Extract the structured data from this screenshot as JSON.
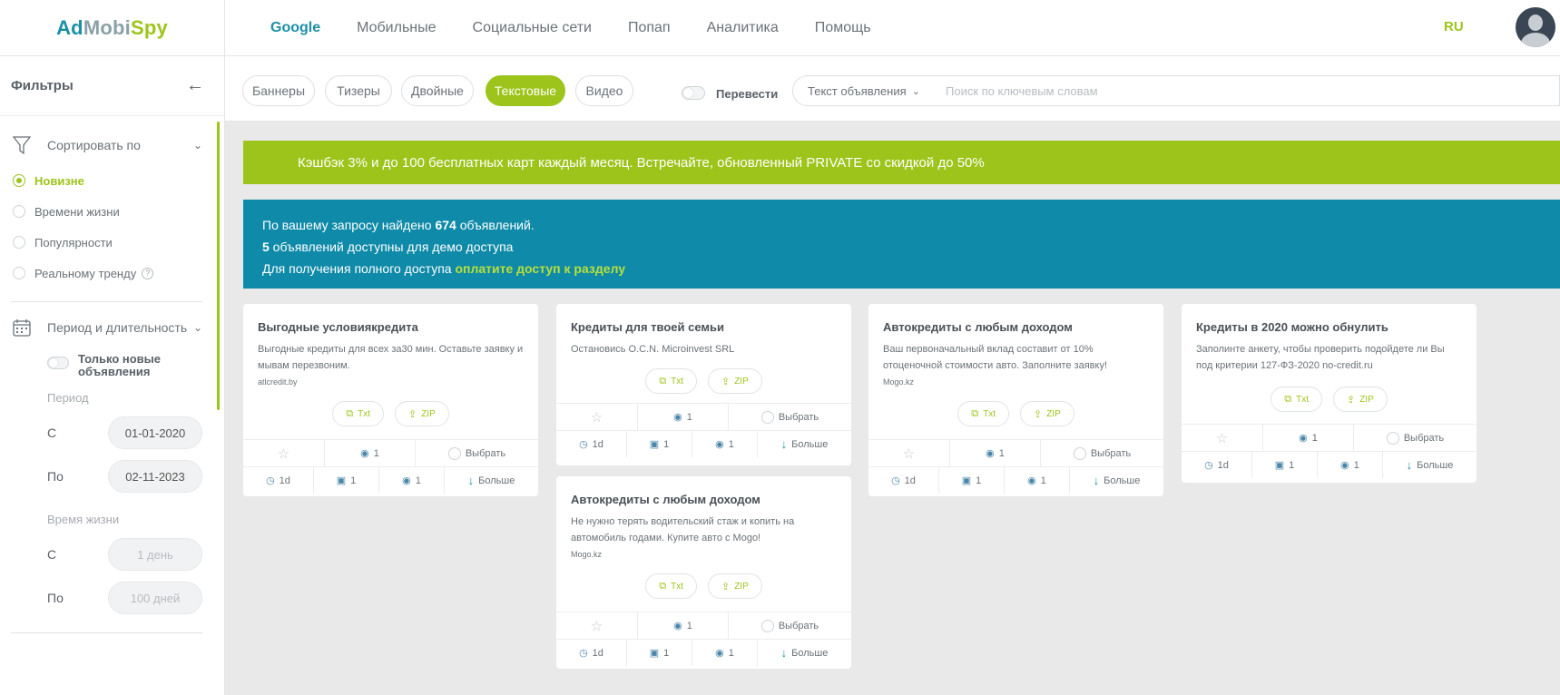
{
  "logo": {
    "part1": "Ad",
    "part2": "Mobi",
    "part3": "Spy"
  },
  "nav": [
    {
      "label": "Google",
      "active": true
    },
    {
      "label": "Мобильные",
      "active": false
    },
    {
      "label": "Социальные сети",
      "active": false
    },
    {
      "label": "Попап",
      "active": false
    },
    {
      "label": "Аналитика",
      "active": false
    },
    {
      "label": "Помощь",
      "active": false
    }
  ],
  "lang": "RU",
  "sidebar": {
    "title": "Фильтры",
    "sort": {
      "label": "Сортировать по",
      "options": [
        "Новизне",
        "Времени жизни",
        "Популярности",
        "Реальному тренду"
      ],
      "selected": 0,
      "help": "?"
    },
    "period": {
      "label": "Период и длительность",
      "toggle_label": "Только новые объявления",
      "period_label": "Период",
      "from_label": "С",
      "from_value": "01-01-2020",
      "to_label": "По",
      "to_value": "02-11-2023",
      "lifetime_label": "Время жизни",
      "life_from_label": "С",
      "life_from_placeholder": "1 день",
      "life_to_label": "По",
      "life_to_placeholder": "100 дней"
    }
  },
  "toolbar": {
    "types": [
      "Баннеры",
      "Тизеры",
      "Двойные",
      "Текстовые",
      "Видео"
    ],
    "active_type": 3,
    "translate_label": "Перевести",
    "select_value": "Текст объявления",
    "search_placeholder": "Поиск по ключевым словам"
  },
  "promo": "Кэшбэк 3% и до 100 бесплатных карт каждый месяц. Встречайте, обновленный PRIVATE со скидкой до 50%",
  "info": {
    "line1_pre": "По вашему запросу найдено ",
    "line1_count": "674",
    "line1_post": " объявлений.",
    "line2_count": "5",
    "line2_post": " объявлений доступны для демо доступа",
    "line3_pre": "Для получения полного доступа ",
    "line3_link": "оплатите доступ к разделу"
  },
  "card_labels": {
    "txt": "Txt",
    "zip": "ZIP",
    "select": "Выбрать",
    "more": "Больше"
  },
  "cards": [
    {
      "title": "Выгодные условиякредита",
      "desc": "Выгодные кредиты для всех за30 мин. Оставьте заявку и мывам перезвоним.",
      "domain": "atlcredit.by",
      "views": "1",
      "age": "1d",
      "devices": "1",
      "geos": "1"
    },
    {
      "title": "Кредиты для твоей семьи",
      "desc": "Остановись O.C.N. Microinvest SRL",
      "domain": "",
      "views": "1",
      "age": "1d",
      "devices": "1",
      "geos": "1"
    },
    {
      "title": "Автокредиты с любым доходом",
      "desc": "Ваш первоначальный вклад составит от 10% отоценочной стоимости авто. Заполните заявку!",
      "domain": "Mogo.kz",
      "views": "1",
      "age": "1d",
      "devices": "1",
      "geos": "1"
    },
    {
      "title": "Кредиты в 2020 можно обнулить",
      "desc": "Заполинте анкету, чтобы проверить подойдете ли Вы под критерии 127-ФЗ-2020 no-credit.ru",
      "domain": "",
      "views": "1",
      "age": "1d",
      "devices": "1",
      "geos": "1"
    },
    {
      "title": "Автокредиты с любым доходом",
      "desc": "Не нужно терять водительский стаж и копить на автомобиль годами. Купите авто с Mogo!",
      "domain": "Mogo.kz",
      "views": "1",
      "age": "1d",
      "devices": "1",
      "geos": "1"
    }
  ]
}
